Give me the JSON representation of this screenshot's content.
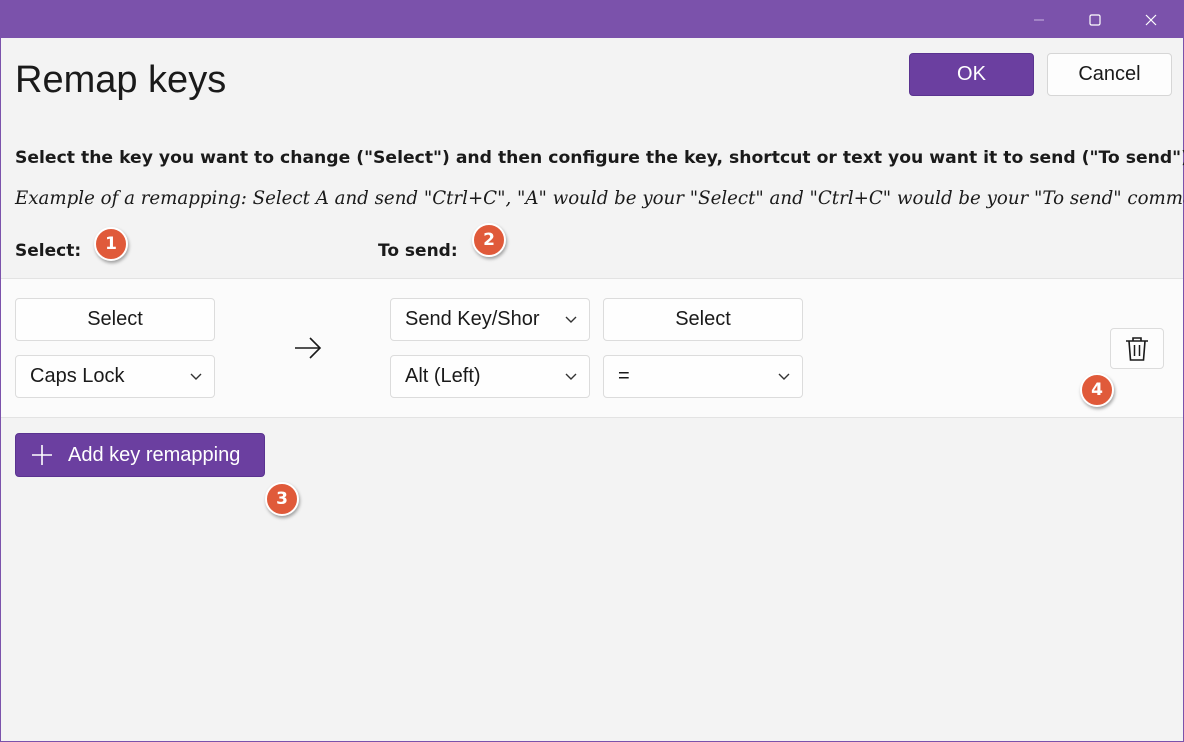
{
  "window": {
    "controls": [
      {
        "name": "minimize-button",
        "icon": "minimize-icon"
      },
      {
        "name": "maximize-button",
        "icon": "maximize-icon"
      },
      {
        "name": "close-window-button",
        "icon": "close-icon"
      }
    ]
  },
  "header": {
    "title": "Remap keys",
    "ok_label": "OK",
    "cancel_label": "Cancel"
  },
  "instructions": {
    "main": "Select the key you want to change (\"Select\") and then configure the key, shortcut or text you want it to send (\"To send\").",
    "example": "Example of a remapping: Select A and send \"Ctrl+C\", \"A\" would be your \"Select\" and \"Ctrl+C\" would be your \"To send\" command."
  },
  "columns": {
    "select_label": "Select:",
    "to_send_label": "To send:"
  },
  "badges": [
    "1",
    "2",
    "3",
    "4"
  ],
  "remapping": {
    "select_button": "Select",
    "original_key": "Caps Lock",
    "action_type": "Send Key/Shor",
    "target_select_button": "Select",
    "target_key": "Alt (Left)",
    "target_key2": "=",
    "arrow_icon": "arrow-right-icon",
    "delete_icon": "trash-icon"
  },
  "add_button": {
    "label": "Add key remapping",
    "icon": "plus-icon"
  },
  "colors": {
    "accent": "#6b3fa0",
    "titlebar": "#7b52ab",
    "badge": "#e05a3a"
  }
}
